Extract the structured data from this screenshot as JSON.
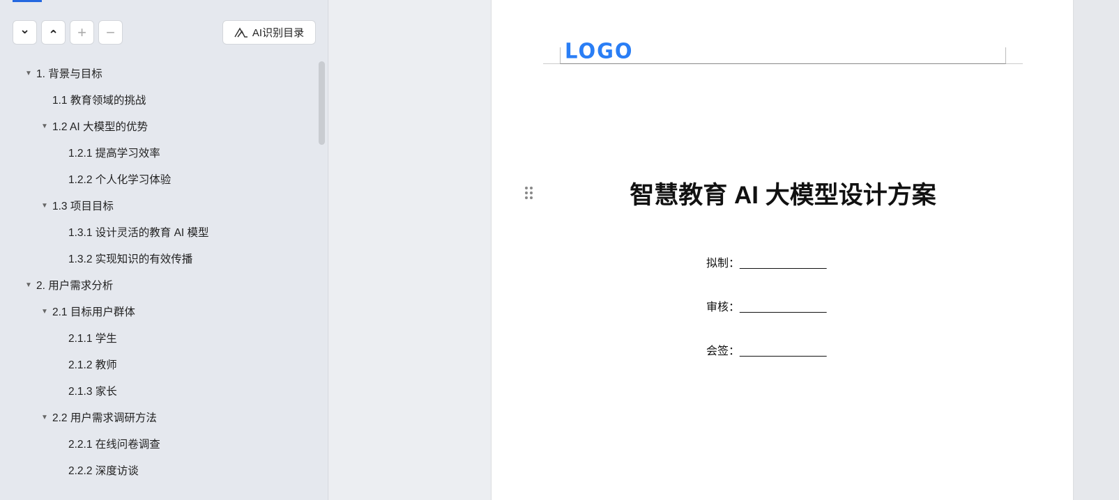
{
  "toolbar": {
    "expand": "⌄",
    "collapse": "⌃",
    "add": "+",
    "remove": "−",
    "ai_label": "AI识别目录"
  },
  "toc": [
    {
      "label": "1. 背景与目标",
      "level": 1,
      "arrow": true
    },
    {
      "label": "1.1 教育领域的挑战",
      "level": 2,
      "arrow": false
    },
    {
      "label": "1.2 AI 大模型的优势",
      "level": 2,
      "arrow": true
    },
    {
      "label": "1.2.1 提高学习效率",
      "level": 3,
      "arrow": false
    },
    {
      "label": "1.2.2 个人化学习体验",
      "level": 3,
      "arrow": false
    },
    {
      "label": "1.3 项目目标",
      "level": 2,
      "arrow": true
    },
    {
      "label": "1.3.1 设计灵活的教育 AI 模型",
      "level": 3,
      "arrow": false
    },
    {
      "label": "1.3.2 实现知识的有效传播",
      "level": 3,
      "arrow": false
    },
    {
      "label": "2. 用户需求分析",
      "level": 1,
      "arrow": true
    },
    {
      "label": "2.1 目标用户群体",
      "level": 2,
      "arrow": true
    },
    {
      "label": "2.1.1 学生",
      "level": 3,
      "arrow": false
    },
    {
      "label": "2.1.2 教师",
      "level": 3,
      "arrow": false
    },
    {
      "label": "2.1.3 家长",
      "level": 3,
      "arrow": false
    },
    {
      "label": "2.2 用户需求调研方法",
      "level": 2,
      "arrow": true
    },
    {
      "label": "2.2.1 在线问卷调查",
      "level": 3,
      "arrow": false
    },
    {
      "label": "2.2.2 深度访谈",
      "level": 3,
      "arrow": false
    }
  ],
  "document": {
    "logo": "LOGO",
    "title": "智慧教育 AI 大模型设计方案",
    "signatures": [
      "拟制：______________",
      "审核：______________",
      "会签：______________"
    ]
  }
}
